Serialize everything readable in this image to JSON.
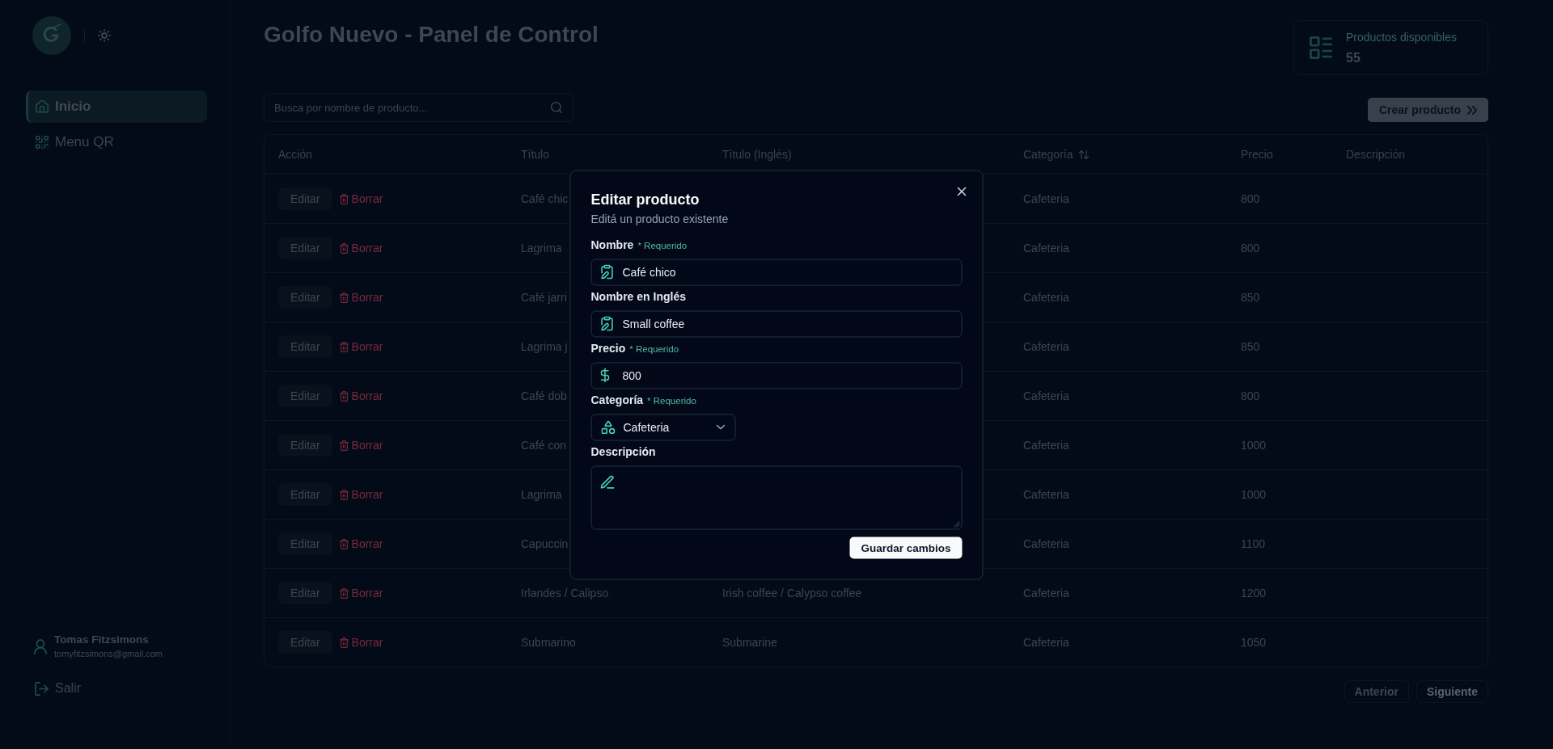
{
  "sidebar": {
    "items": [
      {
        "label": "Inicio",
        "selected": true
      },
      {
        "label": "Menu QR",
        "selected": false
      }
    ],
    "user": {
      "name": "Tomas Fitzsimons",
      "email": "tomyfitzsimons@gmail.com"
    },
    "logout": "Salir"
  },
  "header": {
    "title": "Golfo Nuevo - Panel de Control",
    "stat": {
      "label": "Productos disponibles",
      "value": "55"
    }
  },
  "toolbar": {
    "search": {
      "placeholder": "Busca por nombre de producto..."
    },
    "create_button": "Crear producto"
  },
  "table": {
    "columns": [
      {
        "label": "Acción",
        "sortable": false
      },
      {
        "label": "Título",
        "sortable": false
      },
      {
        "label": "Título (Inglés)",
        "sortable": false
      },
      {
        "label": "Categoría",
        "sortable": true
      },
      {
        "label": "Precio",
        "sortable": false
      },
      {
        "label": "Descripción",
        "sortable": false
      }
    ],
    "rows": [
      {
        "edit": "Editar",
        "delete": "Borrar",
        "title": "Café chic",
        "category": "Cafeteria",
        "price": "800"
      },
      {
        "edit": "Editar",
        "delete": "Borrar",
        "title": "Lagrima",
        "category": "Cafeteria",
        "price": "800"
      },
      {
        "edit": "Editar",
        "delete": "Borrar",
        "title": "Café jarri",
        "category": "Cafeteria",
        "price": "850"
      },
      {
        "edit": "Editar",
        "delete": "Borrar",
        "title": "Lagrima j",
        "category": "Cafeteria",
        "price": "850"
      },
      {
        "edit": "Editar",
        "delete": "Borrar",
        "title": "Café dob",
        "category": "Cafeteria",
        "price": "800"
      },
      {
        "edit": "Editar",
        "delete": "Borrar",
        "title": "Café con",
        "category": "Cafeteria",
        "price": "1000"
      },
      {
        "edit": "Editar",
        "delete": "Borrar",
        "title": "Lagrima",
        "category": "Cafeteria",
        "price": "1000"
      },
      {
        "edit": "Editar",
        "delete": "Borrar",
        "title": "Capuccin",
        "category": "Cafeteria",
        "price": "1100"
      },
      {
        "edit": "Editar",
        "delete": "Borrar",
        "title": "Irlandes / Calipso",
        "title_en": "Irish coffee / Calypso coffee",
        "category": "Cafeteria",
        "price": "1200"
      },
      {
        "edit": "Editar",
        "delete": "Borrar",
        "title": "Submarino",
        "title_en": "Submarine",
        "category": "Cafeteria",
        "price": "1050"
      }
    ]
  },
  "pagination": [
    {
      "label": "Anterior",
      "disabled": true
    },
    {
      "label": "Siguiente",
      "disabled": false
    }
  ],
  "modal": {
    "title": "Editar producto",
    "subtitle": "Editá un producto existente",
    "fields": [
      {
        "kind": "text",
        "label": "Nombre",
        "note": "* Requerido",
        "value": "Café chico"
      },
      {
        "kind": "text",
        "label": "Nombre en Inglés",
        "value": "Small coffee"
      },
      {
        "kind": "price",
        "label": "Precio",
        "note": "* Requerido",
        "value": "800"
      },
      {
        "kind": "select",
        "label": "Categoría",
        "note": "* Requerido",
        "value": "Cafeteria"
      },
      {
        "kind": "textarea",
        "label": "Descripción"
      }
    ],
    "submit": "Guardar cambios"
  }
}
